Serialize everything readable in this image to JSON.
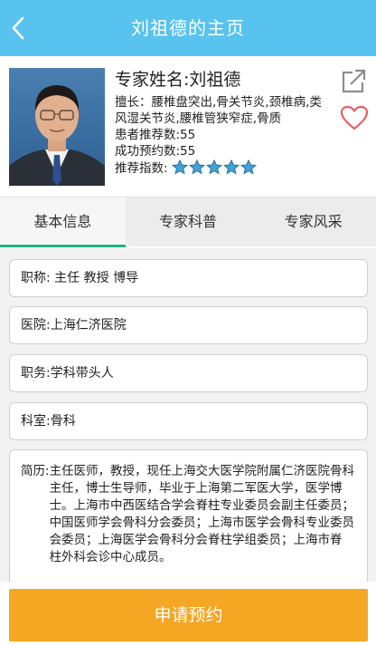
{
  "header": {
    "title": "刘祖德的主页",
    "accent_color": "#58c3ee"
  },
  "profile": {
    "name": "专家姓名:刘祖德",
    "specialty": "擅长：腰椎盘突出,骨关节炎,颈椎病,类风湿关节炎,腰椎管狭窄症,骨质",
    "recommend_count": "患者推荐数:55",
    "booking_count": "成功预约数:55",
    "rating_label": "推荐指数:",
    "rating": 5
  },
  "tabs": [
    {
      "label": "基本信息",
      "active": true
    },
    {
      "label": "专家科普",
      "active": false
    },
    {
      "label": "专家风采",
      "active": false
    }
  ],
  "fields": {
    "title": "职称:   主任   教授   博导",
    "hospital": "医院:上海仁济医院",
    "position": "职务:学科带头人",
    "department": "科室:骨科"
  },
  "bio": {
    "label": "简历:",
    "text": "主任医师，教授，现任上海交大医学院附属仁济医院骨科主任，博士生导师，毕业于上海第二军医大学，医学博士。上海市中西医结合学会脊柱专业委员会副主任委员；中国医师学会骨科分会委员；上海市医学会骨科专业委员会委员；上海医学会骨科分会脊柱学组委员；上海市脊 柱外科会诊中心成员。"
  },
  "apply_button": {
    "label": "申请预约",
    "color": "#f5a623"
  },
  "icons": {
    "back": "chevron-left-icon",
    "share": "share-icon",
    "favorite": "heart-icon",
    "star": "star-icon"
  }
}
